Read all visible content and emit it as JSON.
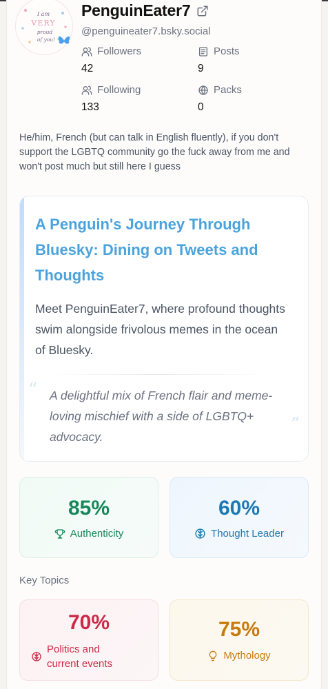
{
  "profile": {
    "display_name": "PenguinEater7",
    "handle": "@penguineater7.bsky.social",
    "avatar_text": [
      "I am",
      "VERY",
      "proud",
      "of you!"
    ],
    "bio": "He/him, French (but can talk in English fluently), if you don't support the LGBTQ community go the fuck away from me and won't post much but still here I guess"
  },
  "stats": {
    "followers": {
      "label": "Followers",
      "value": "42",
      "icon": "users-icon"
    },
    "posts": {
      "label": "Posts",
      "value": "9",
      "icon": "newspaper-icon"
    },
    "following": {
      "label": "Following",
      "value": "133",
      "icon": "users-icon"
    },
    "packs": {
      "label": "Packs",
      "value": "0",
      "icon": "globe-icon"
    }
  },
  "story": {
    "title": "A Penguin's Journey Through Bluesky: Dining on Tweets and Thoughts",
    "body": "Meet PenguinEater7, where profound thoughts swim alongside frivolous memes in the ocean of Bluesky.",
    "quote": "A delightful mix of French flair and meme-loving mischief with a side of LGBTQ+ advocacy.",
    "quote_open": "“",
    "quote_close": "”"
  },
  "scores": [
    {
      "value": "85%",
      "label": "Authenticity",
      "icon": "trophy-icon",
      "color": "#15875a"
    },
    {
      "value": "60%",
      "label": "Thought Leader",
      "icon": "brain-icon",
      "color": "#1d79b4"
    }
  ],
  "key_topics": {
    "label": "Key Topics",
    "items": [
      {
        "value": "70%",
        "label_line1": "Politics and",
        "label_line2": "current events",
        "icon": "brain-icon",
        "color": "#cc2a47"
      },
      {
        "value": "75%",
        "label": "Mythology",
        "icon": "lightbulb-icon",
        "color": "#c87a0d"
      }
    ]
  }
}
